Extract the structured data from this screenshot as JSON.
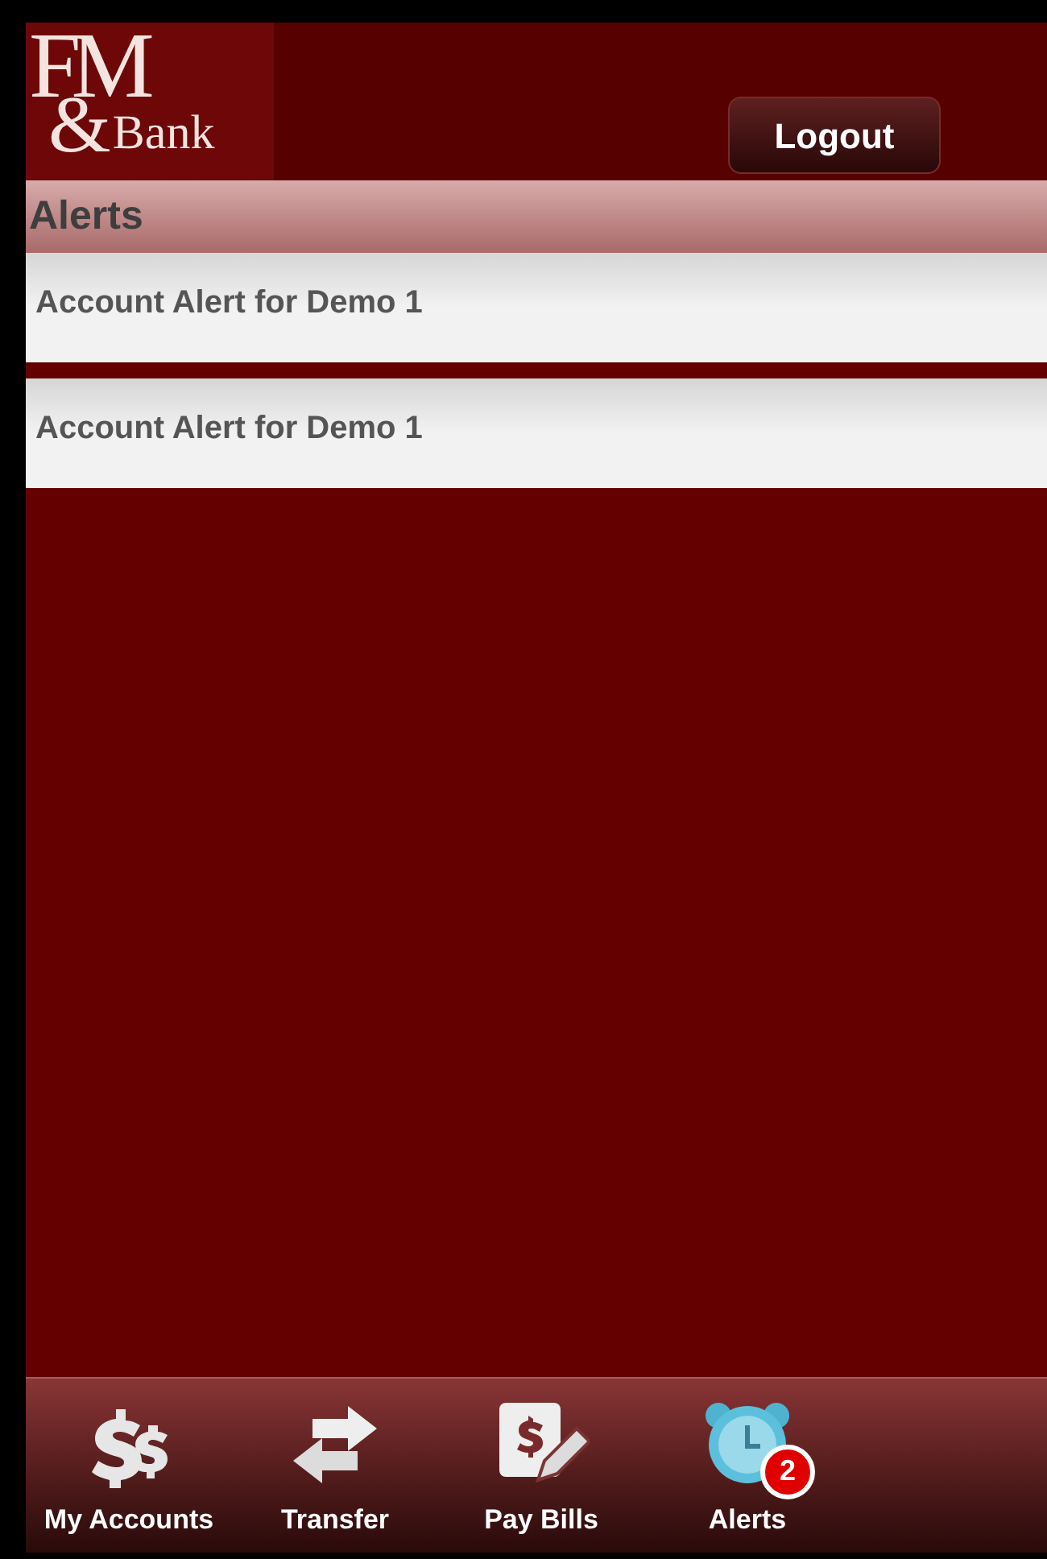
{
  "header": {
    "logo": {
      "top": "FM",
      "ampersand": "&",
      "bottom": "Bank"
    },
    "logout_button": "Logout"
  },
  "section_title": "Alerts",
  "alerts": [
    {
      "title": "Account Alert for Demo 1"
    },
    {
      "title": "Account Alert for Demo 1"
    }
  ],
  "tab_bar": [
    {
      "kind": "accounts",
      "label": "My Accounts"
    },
    {
      "kind": "transfer",
      "label": "Transfer"
    },
    {
      "kind": "bills",
      "label": "Pay Bills"
    },
    {
      "kind": "alerts",
      "label": "Alerts",
      "badge": "2"
    }
  ]
}
